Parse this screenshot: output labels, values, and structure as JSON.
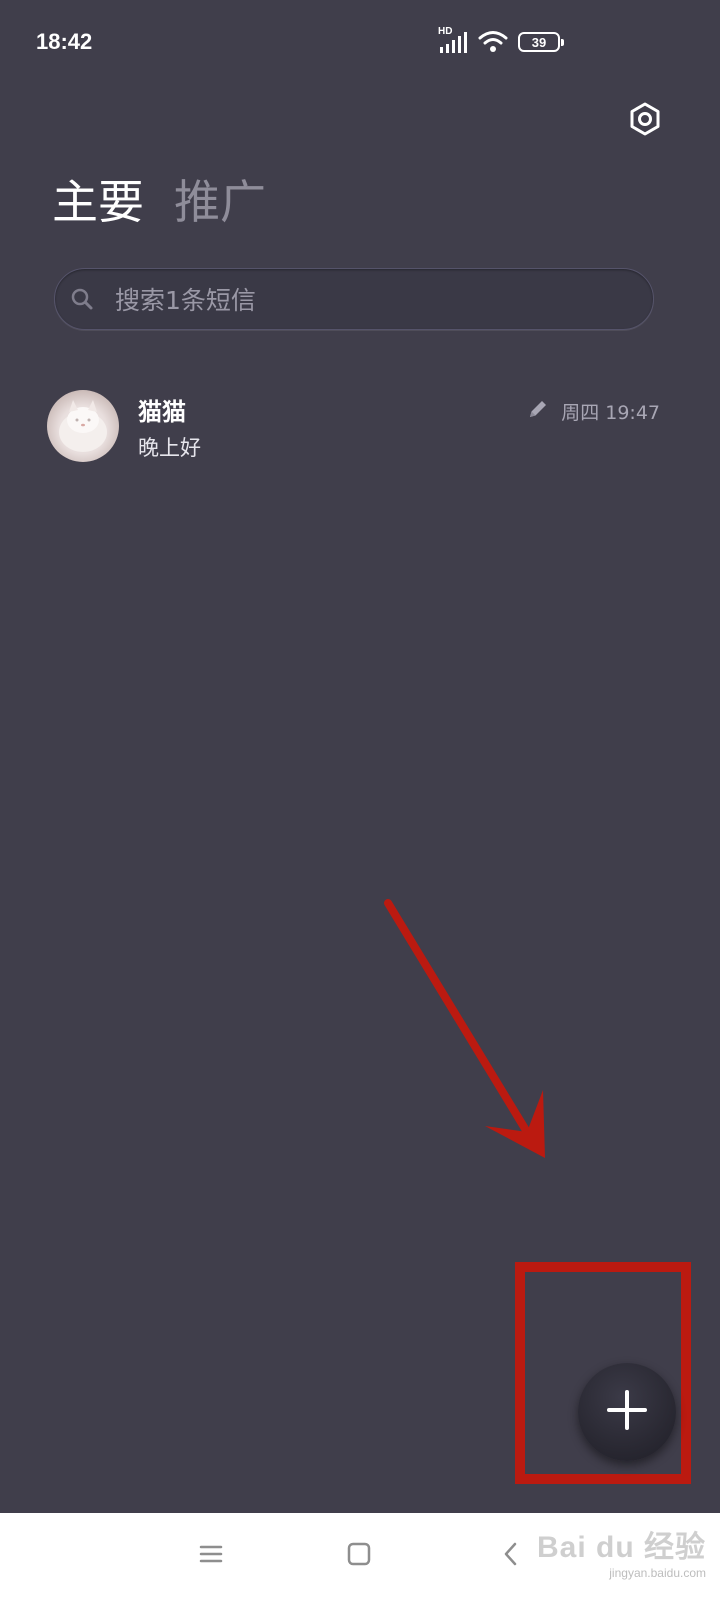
{
  "status_bar": {
    "time": "18:42",
    "network_label": "HD",
    "battery_level": "39",
    "icons": [
      "signal-icon",
      "wifi-icon",
      "battery-icon"
    ]
  },
  "header": {
    "settings_icon": "gear-icon"
  },
  "tabs": [
    {
      "label": "主要",
      "active": true
    },
    {
      "label": "推广",
      "active": false
    }
  ],
  "search": {
    "placeholder": "搜索1条短信",
    "icon": "search-icon"
  },
  "conversations": [
    {
      "name": "猫猫",
      "preview": "晚上好",
      "timestamp": "周四 19:47",
      "status_icon": "pencil-icon",
      "avatar": "cat-avatar"
    }
  ],
  "fab": {
    "icon": "plus-icon"
  },
  "annotation": {
    "color": "#bb1a10"
  },
  "nav_bar": {
    "items": [
      "menu-icon",
      "home-icon",
      "back-icon"
    ]
  },
  "watermark": {
    "main": "Bai du 经验",
    "url": "jingyan.baidu.com"
  },
  "colors": {
    "background": "#403e4b",
    "accent_annotation": "#bb1a10"
  }
}
